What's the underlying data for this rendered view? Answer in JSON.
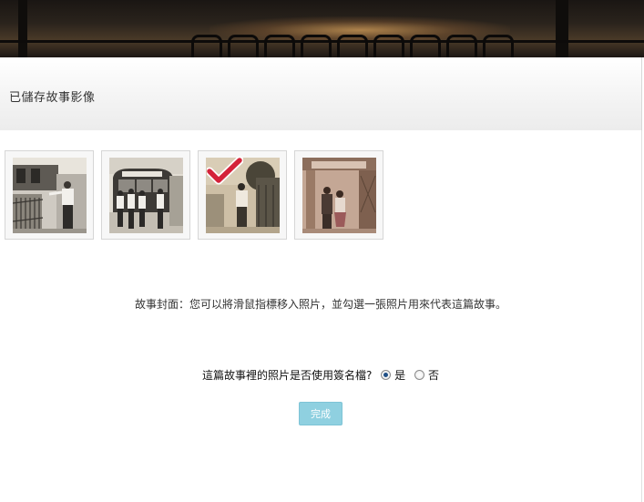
{
  "header": {
    "title": "已儲存故事影像"
  },
  "photos": [
    {
      "name": "photo-man-at-gate",
      "selected": false
    },
    {
      "name": "photo-group-with-bus",
      "selected": false
    },
    {
      "name": "photo-man-standing",
      "selected": true
    },
    {
      "name": "photo-couple-at-archway",
      "selected": false
    }
  ],
  "cover_note": "故事封面：您可以將滑鼠指標移入照片，並勾選一張照片用來代表這篇故事。",
  "anonymous_question": {
    "label": "這篇故事裡的照片是否使用簽名檔?",
    "options": [
      {
        "label": "是",
        "checked": true
      },
      {
        "label": "否",
        "checked": false
      }
    ]
  },
  "done_button": {
    "label": "完成"
  },
  "colors": {
    "accent_button": "#8fd0e0",
    "checkmark": "#d4233a"
  },
  "icons": {
    "selected": "checkmark-icon"
  }
}
